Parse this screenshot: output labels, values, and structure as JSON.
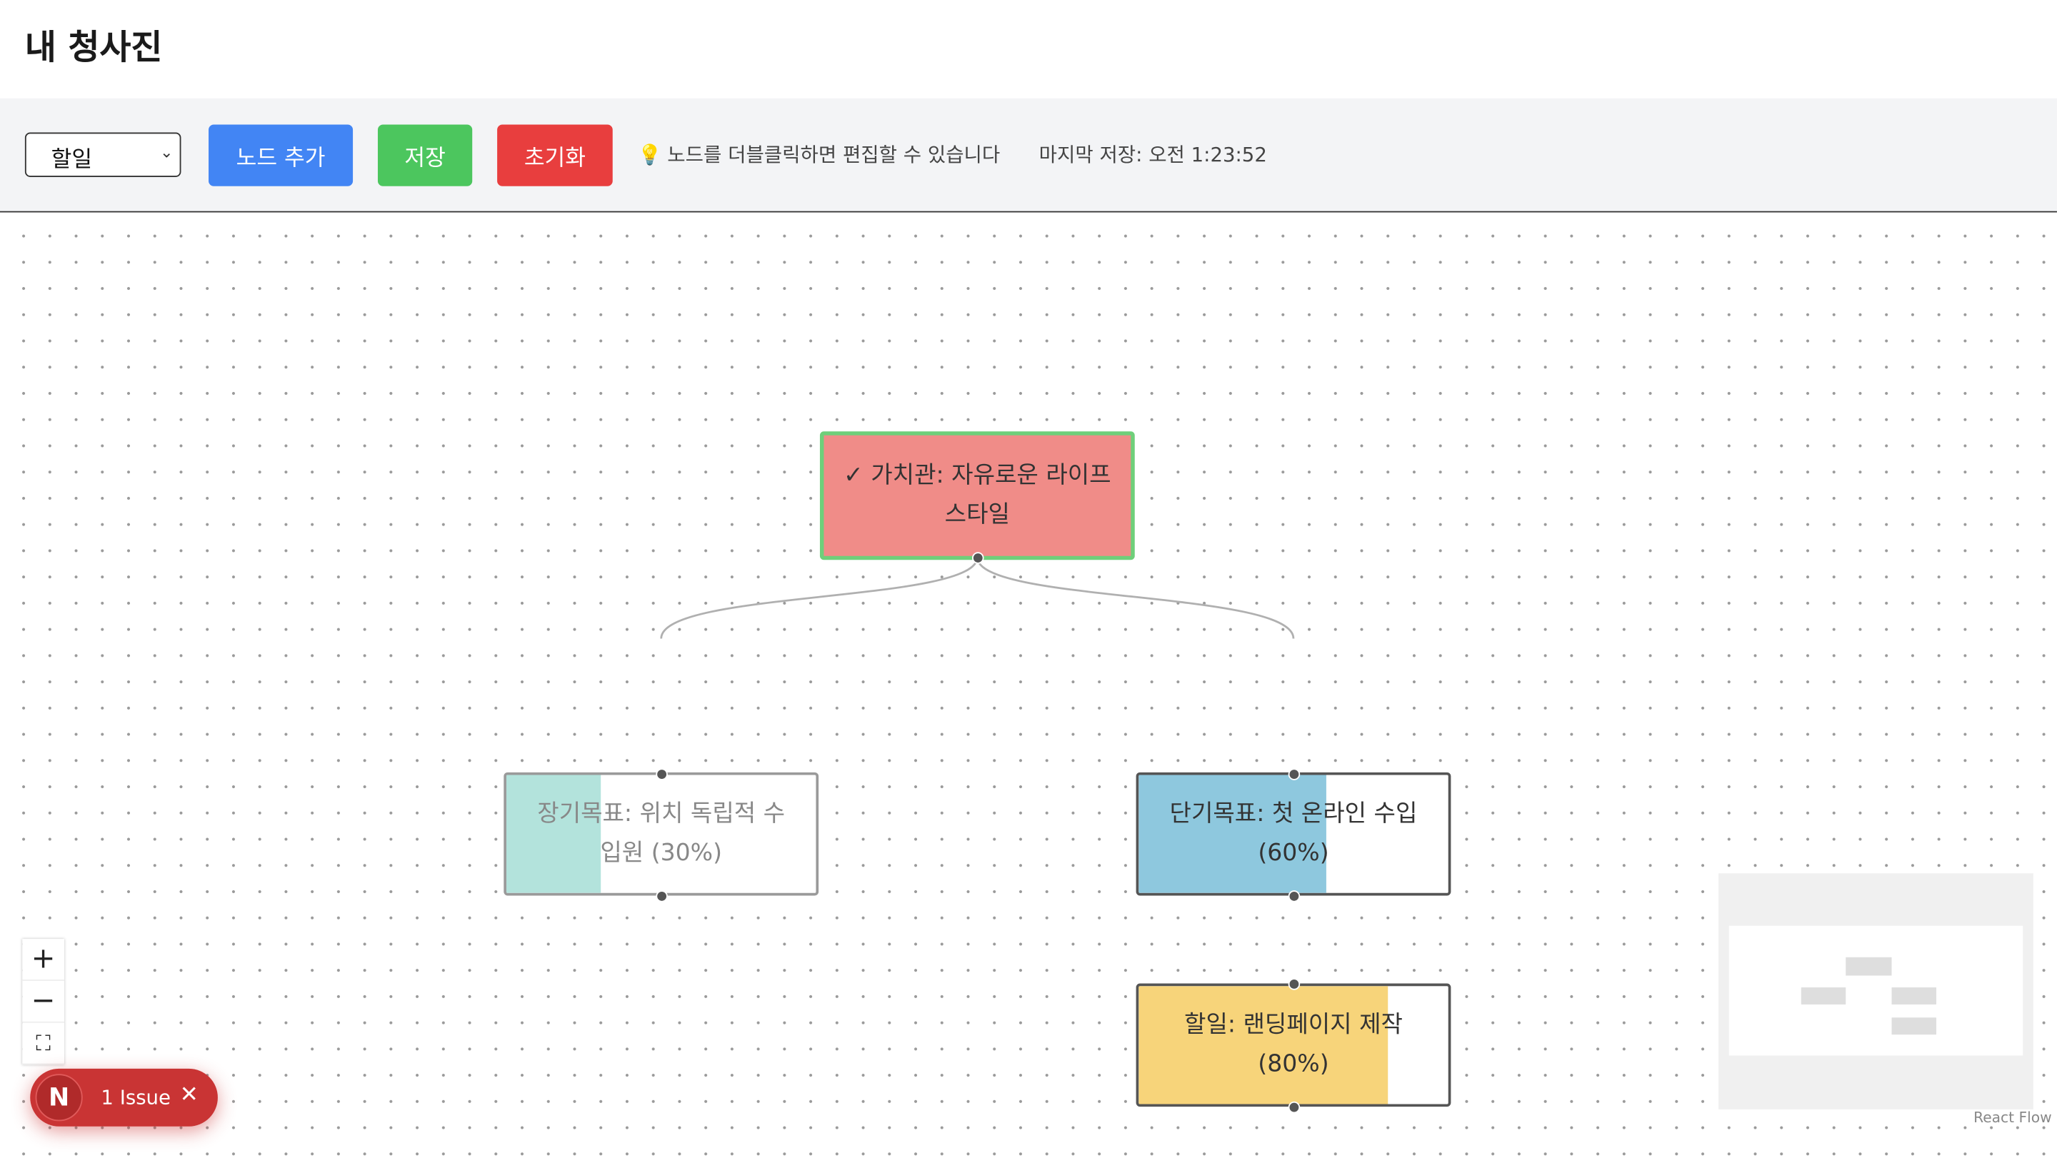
{
  "header": {
    "title": "내 청사진"
  },
  "toolbar": {
    "node_type_selected": "할일",
    "add_node_label": "노드 추가",
    "save_label": "저장",
    "reset_label": "초기화",
    "hint_icon": "💡",
    "hint_text": "노드를 더블클릭하면 편집할 수 있습니다",
    "last_saved": "마지막 저장: 오전 1:23:52"
  },
  "nodes": {
    "value": {
      "label": "✓ 가치관: 자유로운 라이프스타일",
      "line1": "✓ 가치관: 자유로운 라이프",
      "line2": "스타일"
    },
    "long_term": {
      "line1": "장기목표: 위치 독립적 수",
      "line2": "입원 (30%)",
      "progress": 0.3
    },
    "short_term": {
      "line1": "단기목표: 첫 온라인 수입",
      "line2": "(60%)",
      "progress": 0.6
    },
    "todo": {
      "line1": "할일: 랜딩페이지 제작",
      "line2": "(80%)",
      "progress": 0.8
    }
  },
  "controls": {
    "zoom_in": "+",
    "zoom_out": "−",
    "fit": "⛶"
  },
  "attribution": "React Flow",
  "issue_badge": {
    "logo": "N",
    "text": "1 Issue",
    "close": "✕"
  },
  "colors": {
    "add": "#4285f4",
    "save": "#4cc65e",
    "reset": "#e83e3e",
    "value_node": "#f08c88",
    "value_border": "#6fcf7a"
  }
}
